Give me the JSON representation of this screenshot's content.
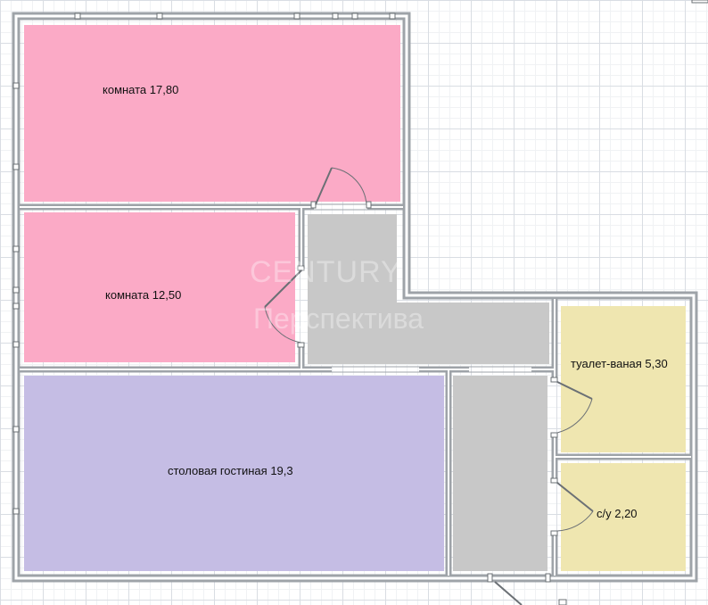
{
  "colors": {
    "bedroom": "#fbaac6",
    "living": "#c5bde4",
    "corridor": "#c8c8c8",
    "bathroom": "#efe6b0",
    "wall": "#9ea3a8",
    "wall_inner": "#ffffff"
  },
  "rooms": {
    "room1": {
      "label": "комната 17,80"
    },
    "room2": {
      "label": "комната 12,50"
    },
    "living": {
      "label": "столовая гостиная 19,3"
    },
    "bath": {
      "label": "туалет-ваная 5,30"
    },
    "wc": {
      "label": "с/у 2,20"
    }
  },
  "watermark": {
    "line1": "CENTURY",
    "line2": "Перспектива"
  }
}
